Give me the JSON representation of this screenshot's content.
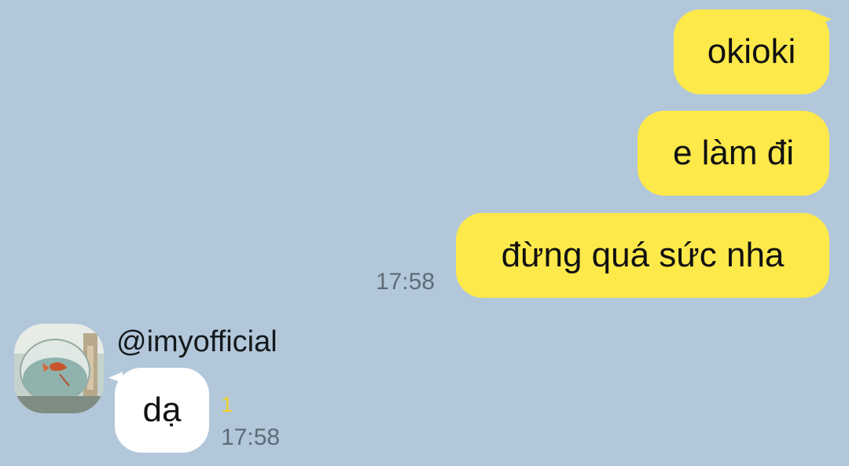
{
  "conversation": {
    "outgoing": [
      {
        "text": "okioki"
      },
      {
        "text": "e làm đi"
      },
      {
        "text": "đừng quá sức nha",
        "time": "17:58"
      }
    ],
    "incoming": {
      "sender": "@imyofficial",
      "message": "dạ",
      "unread_count": "1",
      "time": "17:58"
    }
  },
  "colors": {
    "background": "#b2c7da",
    "outgoing_bubble": "#fee94b",
    "incoming_bubble": "#ffffff",
    "unread": "#f3d12a"
  },
  "icons": {
    "avatar": "goldfish-bowl-photo"
  }
}
